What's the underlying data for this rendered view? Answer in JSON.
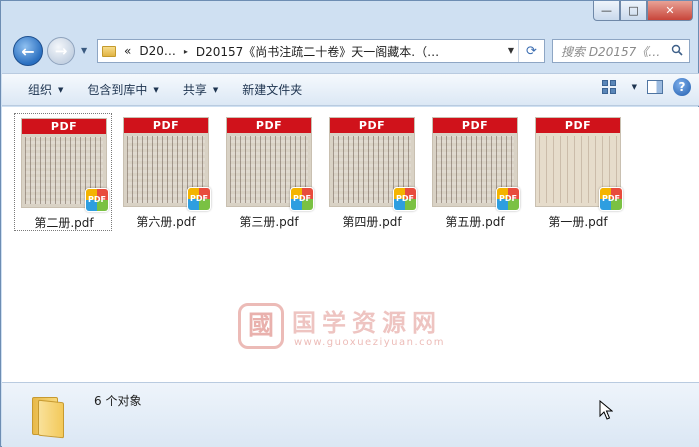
{
  "window": {
    "caption": {
      "minimize": "—",
      "maximize": "□",
      "close": "✕"
    }
  },
  "nav": {
    "back": "←",
    "forward": "→",
    "history_caret": "▼",
    "address": {
      "overflow": "«",
      "segment1": "D20…",
      "separator": "▸",
      "segment2": "D20157《尚书注疏二十卷》天一阁藏本.（…",
      "dropdown": "▼",
      "refresh": "⟳"
    },
    "search_placeholder": "搜索 D20157《…"
  },
  "toolbar": {
    "organize": "组织",
    "include_in_library": "包含到库中",
    "share": "共享",
    "new_folder": "新建文件夹",
    "caret": "▼",
    "help": "?"
  },
  "files": [
    {
      "name": "第二册.pdf",
      "badge": "PDF",
      "selected": true
    },
    {
      "name": "第六册.pdf",
      "badge": "PDF",
      "selected": false
    },
    {
      "name": "第三册.pdf",
      "badge": "PDF",
      "selected": false
    },
    {
      "name": "第四册.pdf",
      "badge": "PDF",
      "selected": false
    },
    {
      "name": "第五册.pdf",
      "badge": "PDF",
      "selected": false
    },
    {
      "name": "第一册.pdf",
      "badge": "PDF",
      "selected": false
    }
  ],
  "watermark": {
    "seal": "國",
    "title": "国学资源网",
    "url": "www.guoxueziyuan.com"
  },
  "details": {
    "count": "6 个对象"
  },
  "colors": {
    "pdf_header": "#d0121b",
    "frame": "#cfe0f2",
    "toolbar_text": "#1e3450"
  }
}
